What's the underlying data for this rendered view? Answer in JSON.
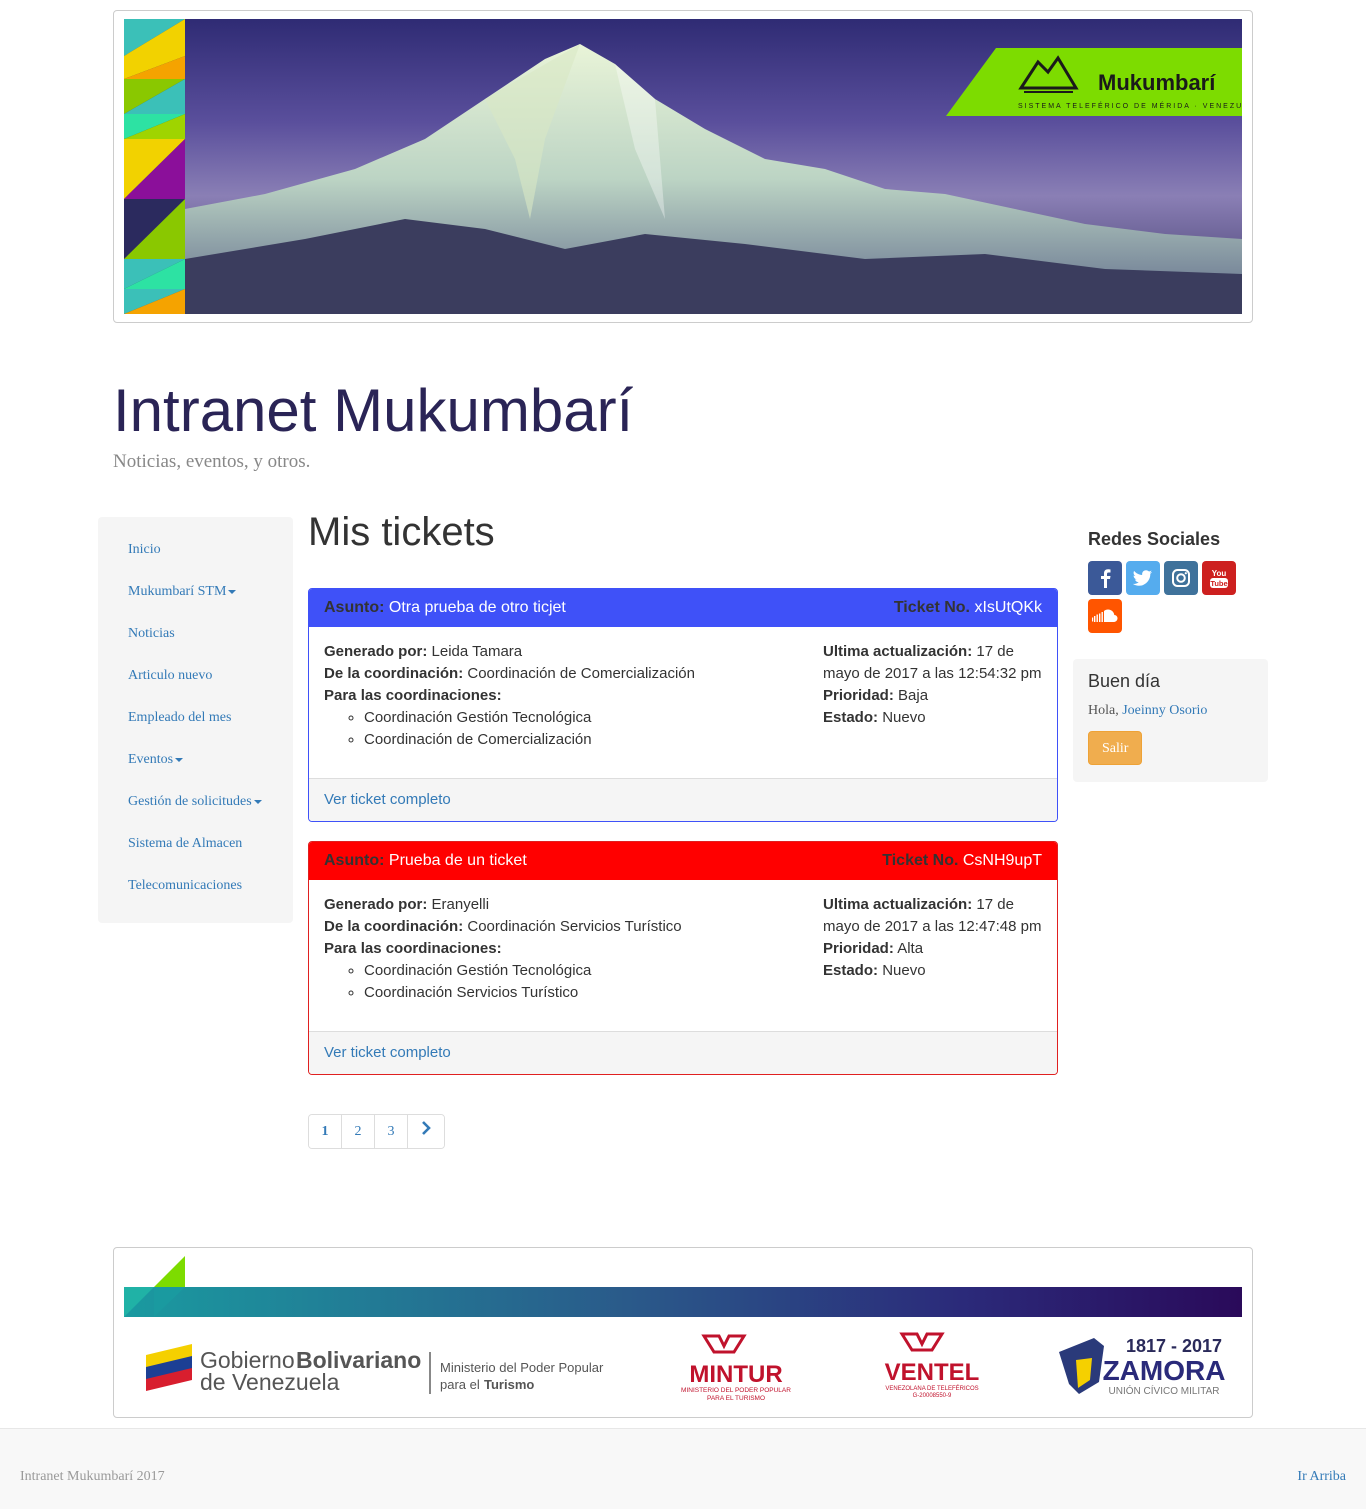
{
  "banner": {
    "brand": "Mukumbarí",
    "tagline": "SISTEMA TELEFÉRICO DE MÉRIDA · VENEZUELA"
  },
  "site": {
    "title": "Intranet Mukumbarí",
    "description": "Noticias, eventos, y otros."
  },
  "nav": {
    "items": [
      {
        "label": "Inicio"
      },
      {
        "label": "Mukumbarí STM"
      },
      {
        "label": "Noticias"
      },
      {
        "label": "Articulo nuevo"
      },
      {
        "label": "Empleado del mes"
      },
      {
        "label": "Eventos"
      },
      {
        "label": "Gestión de solicitudes"
      },
      {
        "label": "Sistema de Almacen"
      },
      {
        "label": "Telecomunicaciones"
      }
    ]
  },
  "main": {
    "heading": "Mis tickets",
    "labels": {
      "asunto": "Asunto:",
      "ticket_no": "Ticket No.",
      "generado": "Generado por:",
      "coordinacion": "De la coordinación:",
      "para": "Para las coordinaciones:",
      "ultima": "Ultima actualización:",
      "prioridad": "Prioridad:",
      "estado": "Estado:",
      "ver": "Ver ticket completo"
    },
    "tickets": [
      {
        "subject": "Otra prueba de otro ticjet",
        "number": "xIsUtQKk",
        "generated_by": "Leida Tamara",
        "from_coord": "Coordinación de Comercialización",
        "to_coords": [
          "Coordinación Gestión Tecnológica",
          "Coordinación de Comercialización"
        ],
        "updated": "17 de mayo de 2017 a las 12:54:32 pm",
        "priority": "Baja",
        "status": "Nuevo",
        "color": "#3f51f8"
      },
      {
        "subject": "Prueba de un ticket",
        "number": "CsNH9upT",
        "generated_by": "Eranyelli",
        "from_coord": "Coordinación Servicios Turístico",
        "to_coords": [
          "Coordinación Gestión Tecnológica",
          "Coordinación Servicios Turístico"
        ],
        "updated": "17 de mayo de 2017 a las 12:47:48 pm",
        "priority": "Alta",
        "status": "Nuevo",
        "color": "#ff0000"
      }
    ],
    "pagination": {
      "pages": [
        "1",
        "2",
        "3"
      ],
      "active": "1"
    }
  },
  "sidebar": {
    "social_heading": "Redes Sociales",
    "social_icons": [
      "facebook-icon",
      "twitter-icon",
      "instagram-icon",
      "youtube-icon",
      "soundcloud-icon"
    ],
    "welcome_heading": "Buen día",
    "greeting": "Hola,",
    "user": "Joeinny Osorio",
    "logout": "Salir"
  },
  "footer_logos": {
    "gob_1": "Gobierno",
    "gob_2": "Bolivariano",
    "gob_3": "de Venezuela",
    "min_1": "Ministerio del Poder Popular",
    "min_2": "para el",
    "min_3": "Turismo",
    "mintur": "MINTUR",
    "mintur_sub1": "MINISTERIO DEL PODER POPULAR",
    "mintur_sub2": "PARA EL TURISMO",
    "ventel": "VENTEL",
    "ventel_sub1": "VENEZOLANA DE TELEFÉRICOS",
    "ventel_sub2": "G-20008550-9",
    "zamora_years": "1817 - 2017",
    "zamora": "ZAMORA",
    "zamora_sub": "UNIÓN CÍVICO MILITAR"
  },
  "bottom": {
    "copyright": "Intranet Mukumbarí 2017",
    "top_link": "Ir Arriba"
  }
}
